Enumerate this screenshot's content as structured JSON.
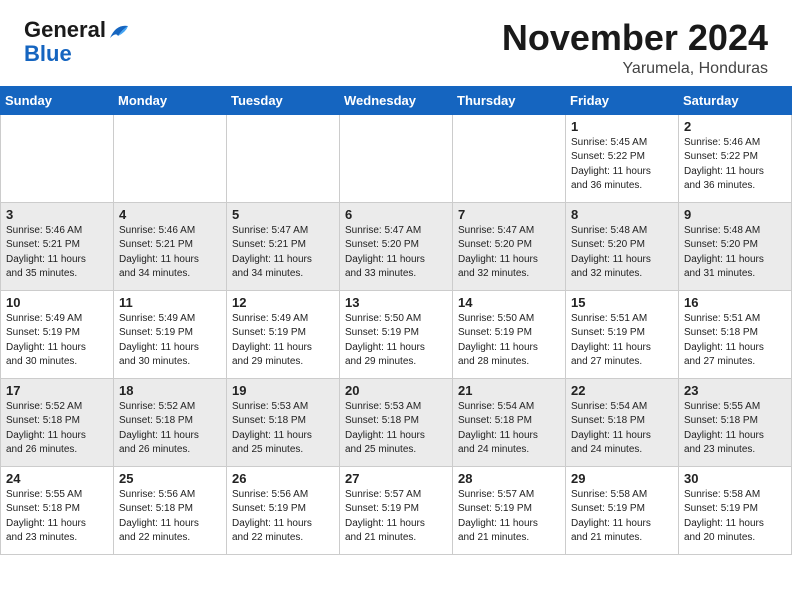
{
  "header": {
    "logo_line1": "General",
    "logo_line2": "Blue",
    "month": "November 2024",
    "location": "Yarumela, Honduras"
  },
  "weekdays": [
    "Sunday",
    "Monday",
    "Tuesday",
    "Wednesday",
    "Thursday",
    "Friday",
    "Saturday"
  ],
  "weeks": [
    [
      {
        "day": "",
        "info": ""
      },
      {
        "day": "",
        "info": ""
      },
      {
        "day": "",
        "info": ""
      },
      {
        "day": "",
        "info": ""
      },
      {
        "day": "",
        "info": ""
      },
      {
        "day": "1",
        "info": "Sunrise: 5:45 AM\nSunset: 5:22 PM\nDaylight: 11 hours\nand 36 minutes."
      },
      {
        "day": "2",
        "info": "Sunrise: 5:46 AM\nSunset: 5:22 PM\nDaylight: 11 hours\nand 36 minutes."
      }
    ],
    [
      {
        "day": "3",
        "info": "Sunrise: 5:46 AM\nSunset: 5:21 PM\nDaylight: 11 hours\nand 35 minutes."
      },
      {
        "day": "4",
        "info": "Sunrise: 5:46 AM\nSunset: 5:21 PM\nDaylight: 11 hours\nand 34 minutes."
      },
      {
        "day": "5",
        "info": "Sunrise: 5:47 AM\nSunset: 5:21 PM\nDaylight: 11 hours\nand 34 minutes."
      },
      {
        "day": "6",
        "info": "Sunrise: 5:47 AM\nSunset: 5:20 PM\nDaylight: 11 hours\nand 33 minutes."
      },
      {
        "day": "7",
        "info": "Sunrise: 5:47 AM\nSunset: 5:20 PM\nDaylight: 11 hours\nand 32 minutes."
      },
      {
        "day": "8",
        "info": "Sunrise: 5:48 AM\nSunset: 5:20 PM\nDaylight: 11 hours\nand 32 minutes."
      },
      {
        "day": "9",
        "info": "Sunrise: 5:48 AM\nSunset: 5:20 PM\nDaylight: 11 hours\nand 31 minutes."
      }
    ],
    [
      {
        "day": "10",
        "info": "Sunrise: 5:49 AM\nSunset: 5:19 PM\nDaylight: 11 hours\nand 30 minutes."
      },
      {
        "day": "11",
        "info": "Sunrise: 5:49 AM\nSunset: 5:19 PM\nDaylight: 11 hours\nand 30 minutes."
      },
      {
        "day": "12",
        "info": "Sunrise: 5:49 AM\nSunset: 5:19 PM\nDaylight: 11 hours\nand 29 minutes."
      },
      {
        "day": "13",
        "info": "Sunrise: 5:50 AM\nSunset: 5:19 PM\nDaylight: 11 hours\nand 29 minutes."
      },
      {
        "day": "14",
        "info": "Sunrise: 5:50 AM\nSunset: 5:19 PM\nDaylight: 11 hours\nand 28 minutes."
      },
      {
        "day": "15",
        "info": "Sunrise: 5:51 AM\nSunset: 5:19 PM\nDaylight: 11 hours\nand 27 minutes."
      },
      {
        "day": "16",
        "info": "Sunrise: 5:51 AM\nSunset: 5:18 PM\nDaylight: 11 hours\nand 27 minutes."
      }
    ],
    [
      {
        "day": "17",
        "info": "Sunrise: 5:52 AM\nSunset: 5:18 PM\nDaylight: 11 hours\nand 26 minutes."
      },
      {
        "day": "18",
        "info": "Sunrise: 5:52 AM\nSunset: 5:18 PM\nDaylight: 11 hours\nand 26 minutes."
      },
      {
        "day": "19",
        "info": "Sunrise: 5:53 AM\nSunset: 5:18 PM\nDaylight: 11 hours\nand 25 minutes."
      },
      {
        "day": "20",
        "info": "Sunrise: 5:53 AM\nSunset: 5:18 PM\nDaylight: 11 hours\nand 25 minutes."
      },
      {
        "day": "21",
        "info": "Sunrise: 5:54 AM\nSunset: 5:18 PM\nDaylight: 11 hours\nand 24 minutes."
      },
      {
        "day": "22",
        "info": "Sunrise: 5:54 AM\nSunset: 5:18 PM\nDaylight: 11 hours\nand 24 minutes."
      },
      {
        "day": "23",
        "info": "Sunrise: 5:55 AM\nSunset: 5:18 PM\nDaylight: 11 hours\nand 23 minutes."
      }
    ],
    [
      {
        "day": "24",
        "info": "Sunrise: 5:55 AM\nSunset: 5:18 PM\nDaylight: 11 hours\nand 23 minutes."
      },
      {
        "day": "25",
        "info": "Sunrise: 5:56 AM\nSunset: 5:18 PM\nDaylight: 11 hours\nand 22 minutes."
      },
      {
        "day": "26",
        "info": "Sunrise: 5:56 AM\nSunset: 5:19 PM\nDaylight: 11 hours\nand 22 minutes."
      },
      {
        "day": "27",
        "info": "Sunrise: 5:57 AM\nSunset: 5:19 PM\nDaylight: 11 hours\nand 21 minutes."
      },
      {
        "day": "28",
        "info": "Sunrise: 5:57 AM\nSunset: 5:19 PM\nDaylight: 11 hours\nand 21 minutes."
      },
      {
        "day": "29",
        "info": "Sunrise: 5:58 AM\nSunset: 5:19 PM\nDaylight: 11 hours\nand 21 minutes."
      },
      {
        "day": "30",
        "info": "Sunrise: 5:58 AM\nSunset: 5:19 PM\nDaylight: 11 hours\nand 20 minutes."
      }
    ]
  ]
}
